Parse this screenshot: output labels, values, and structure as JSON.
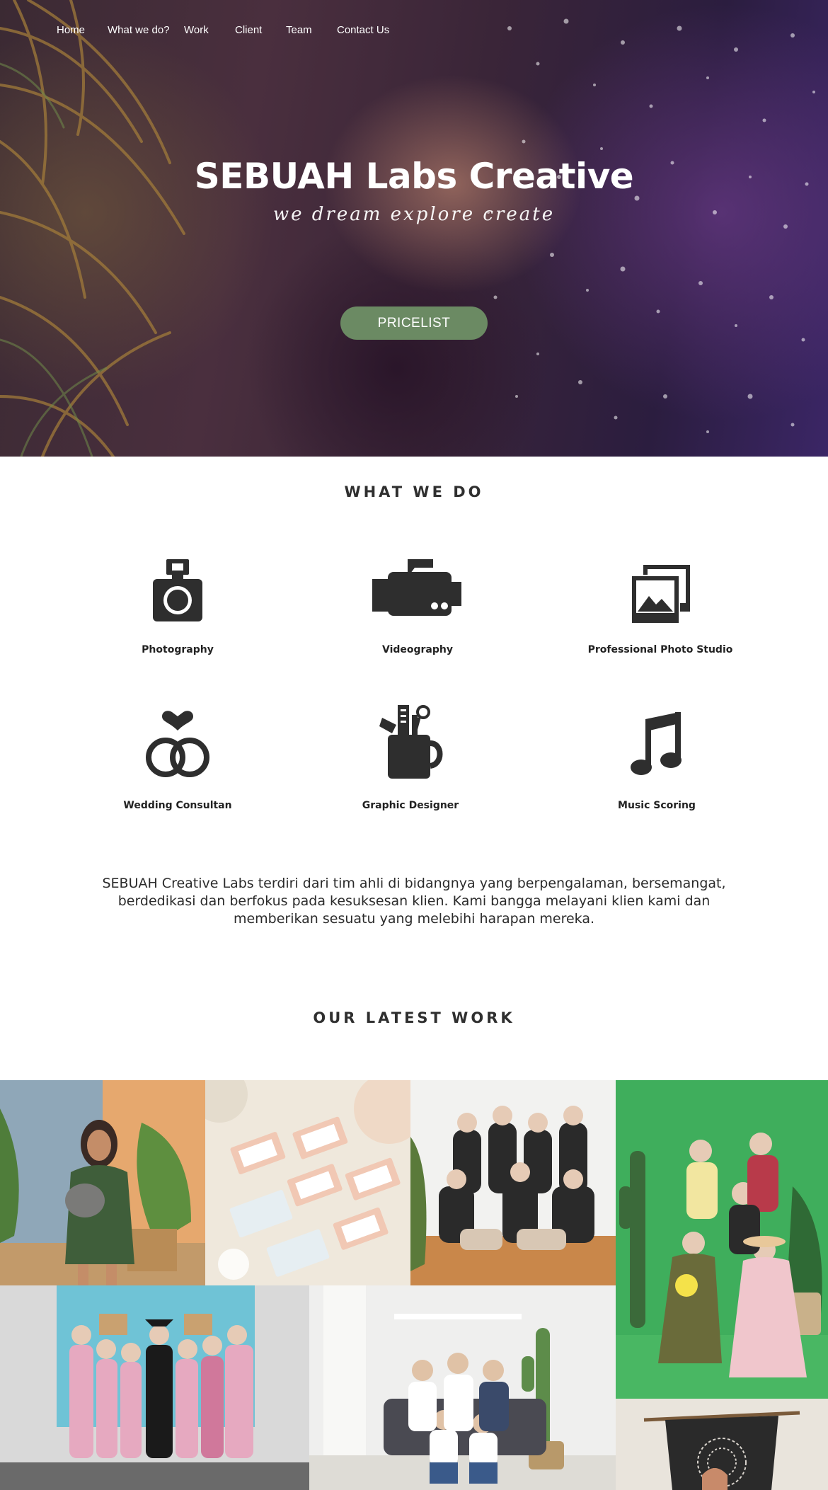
{
  "nav": {
    "items": [
      {
        "label": "Home"
      },
      {
        "label": "What we do?"
      },
      {
        "label": "Work"
      },
      {
        "label": "Client"
      },
      {
        "label": "Team"
      },
      {
        "label": "Contact Us"
      }
    ]
  },
  "hero": {
    "title": "SEBUAH Labs Creative",
    "tagline": "we dream explore create",
    "button_label": "PRICELIST",
    "button_color": "#6b8a63"
  },
  "what_we_do": {
    "heading": "WHAT WE DO",
    "services": [
      {
        "label": "Photography",
        "icon": "camera-icon"
      },
      {
        "label": "Videography",
        "icon": "video-camera-icon"
      },
      {
        "label": "Professional Photo Studio",
        "icon": "photos-icon"
      },
      {
        "label": "Wedding Consultan",
        "icon": "wedding-rings-icon"
      },
      {
        "label": "Graphic Designer",
        "icon": "design-tools-icon"
      },
      {
        "label": "Music Scoring",
        "icon": "music-note-icon"
      }
    ],
    "description": "SEBUAH Creative Labs terdiri dari tim ahli di bidangnya yang berpengalaman, bersemangat, berdedikasi dan berfokus pada kesuksesan klien. Kami bangga melayani klien kami dan memberikan sesuatu yang melebihi harapan mereka."
  },
  "latest_work": {
    "heading": "OUR LATEST WORK",
    "photos": [
      {
        "name": "woman-with-cat-photo"
      },
      {
        "name": "eyelash-product-photo"
      },
      {
        "name": "hijab-group-photo"
      },
      {
        "name": "green-studio-group-photo"
      },
      {
        "name": "graduation-group-photo"
      },
      {
        "name": "family-sofa-photo"
      },
      {
        "name": "macrame-portrait-photo"
      }
    ]
  },
  "colors": {
    "icon": "#2e2e2e",
    "text": "#2b2b2b",
    "accent": "#6b8a63"
  }
}
